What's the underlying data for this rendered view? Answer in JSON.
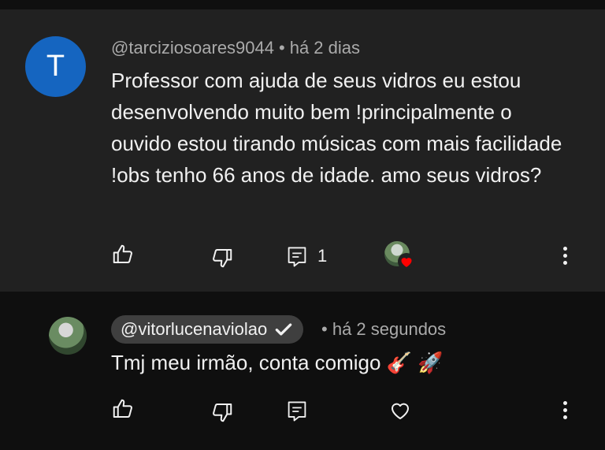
{
  "comment": {
    "avatar_letter": "T",
    "handle": "@tarciziosoares9044",
    "separator": "•",
    "time": "há 2 dias",
    "text": "Professor com ajuda de seus vidros eu estou desenvolvendo muito bem !principalmente o ouvido estou tirando músicas com mais facilidade !obs tenho 66 anos de idade. amo seus vidros?",
    "reply_count": "1",
    "icons": [
      "thumbs-up-icon",
      "thumbs-down-icon",
      "reply-icon",
      "creator-heart-icon",
      "more-icon"
    ]
  },
  "reply": {
    "handle": "@vitorlucenaviolao",
    "separator": "•",
    "time": "há 2 segundos",
    "text": "Tmj meu irmão, conta comigo",
    "emojis": "🎸 🚀",
    "icons": [
      "thumbs-up-icon",
      "thumbs-down-icon",
      "reply-icon",
      "heart-outline-icon",
      "more-icon"
    ]
  },
  "colors": {
    "main_bg": "#212121",
    "reply_bg": "#0f0f0f",
    "avatar_blue": "#1565c0",
    "muted_text": "#aaaaaa",
    "heart_red": "#ff0000"
  }
}
